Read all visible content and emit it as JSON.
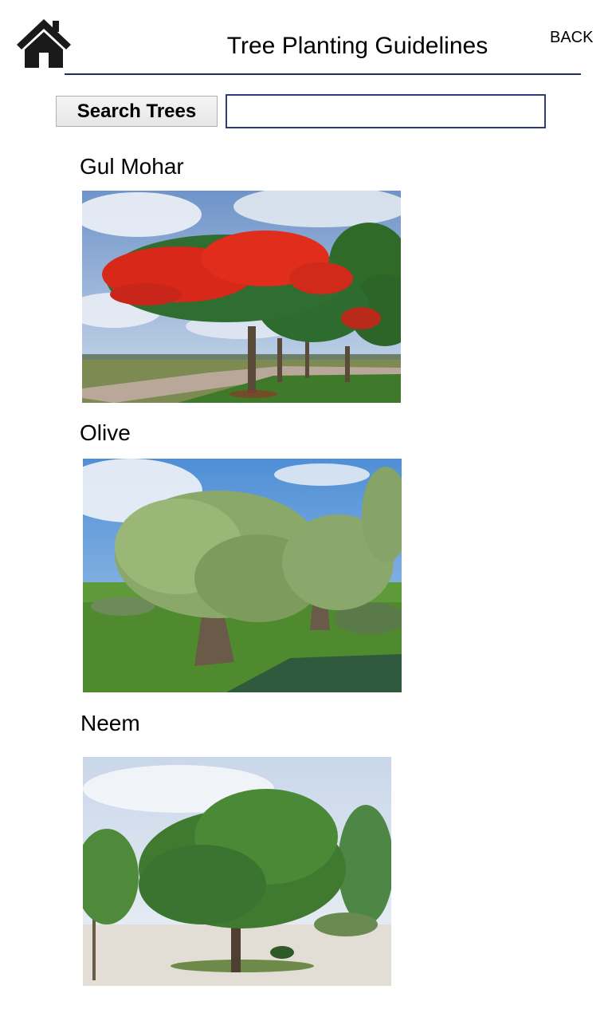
{
  "header": {
    "title": "Tree Planting Guidelines",
    "back_label": "BACK",
    "rule_color": "#1f2d5c"
  },
  "search": {
    "button_label": "Search Trees",
    "value": "",
    "placeholder": ""
  },
  "icons": {
    "home": "home-icon"
  },
  "trees": [
    {
      "name": "Gul Mohar"
    },
    {
      "name": "Olive"
    },
    {
      "name": "Neem"
    }
  ]
}
